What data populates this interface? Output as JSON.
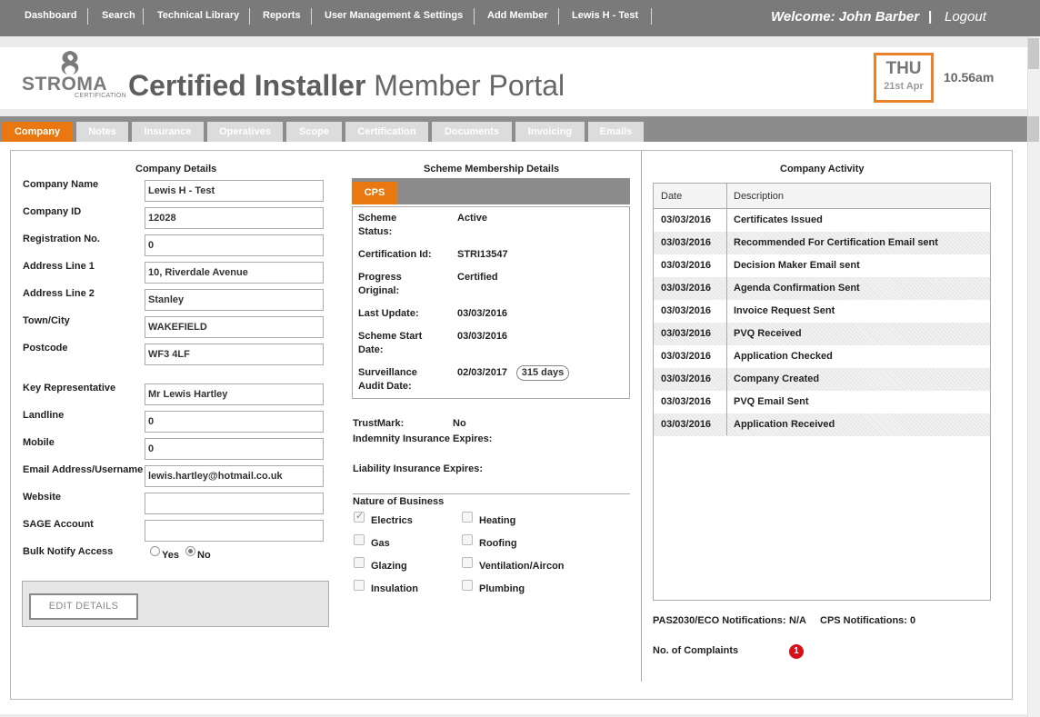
{
  "nav": {
    "items": [
      "Dashboard",
      "Search",
      "Technical Library",
      "Reports",
      "User Management & Settings",
      "Add Member",
      "Lewis H - Test"
    ],
    "welcome": "Welcome: John Barber",
    "welcome_sep": "|",
    "logout": "Logout"
  },
  "header": {
    "logo_brand": "STROMA",
    "logo_sub": "CERTIFICATION",
    "title_bold": "Certified Installer",
    "title_rest": "Member Portal",
    "day": "THU",
    "date": "21st Apr",
    "time": "10.56am"
  },
  "tabs": [
    "Company",
    "Notes",
    "Insurance",
    "Operatives",
    "Scope",
    "Certification",
    "Documents",
    "Invoicing",
    "Emails"
  ],
  "company": {
    "title": "Company Details",
    "fields": [
      {
        "label": "Company Name",
        "value": "Lewis H - Test"
      },
      {
        "label": "Company ID",
        "value": "12028"
      },
      {
        "label": "Registration No.",
        "value": "0"
      },
      {
        "label": "Address Line 1",
        "value": "10, Riverdale Avenue"
      },
      {
        "label": "Address Line 2",
        "value": "Stanley"
      },
      {
        "label": "Town/City",
        "value": "WAKEFIELD"
      },
      {
        "label": "Postcode",
        "value": "WF3 4LF"
      },
      {
        "label": "Key Representative",
        "value": "Mr Lewis Hartley"
      },
      {
        "label": "Landline",
        "value": "0"
      },
      {
        "label": "Mobile",
        "value": "0"
      },
      {
        "label": "Email Address/Username",
        "value": "lewis.hartley@hotmail.co.uk"
      },
      {
        "label": "Website",
        "value": ""
      },
      {
        "label": "SAGE Account",
        "value": ""
      }
    ],
    "bulk_label": "Bulk Notify Access",
    "bulk_yes": "Yes",
    "bulk_no": "No",
    "bulk_selected": "No",
    "edit_button": "EDIT DETAILS"
  },
  "scheme": {
    "title": "Scheme Membership Details",
    "tab": "CPS",
    "status_label": "Scheme Status:",
    "status_value": "Active",
    "cert_label": "Certification Id:",
    "cert_value": "STRI13547",
    "progress_label": "Progress Original:",
    "progress_value": "Certified",
    "last_update_label": "Last Update:",
    "last_update_value": "03/03/2016",
    "start_label": "Scheme Start Date:",
    "start_value": "03/03/2016",
    "audit_label": "Surveillance Audit Date:",
    "audit_value": "02/03/2017",
    "audit_days": "315 days",
    "trustmark_label": "TrustMark:",
    "trustmark_value": "No",
    "indemnity_label": "Indemnity Insurance Expires:",
    "liability_label": "Liability Insurance Expires:",
    "nature_title": "Nature of Business",
    "nature_left": [
      {
        "label": "Electrics",
        "checked": true
      },
      {
        "label": "Gas",
        "checked": false
      },
      {
        "label": "Glazing",
        "checked": false
      },
      {
        "label": "Insulation",
        "checked": false
      }
    ],
    "nature_right": [
      {
        "label": "Heating",
        "checked": false
      },
      {
        "label": "Roofing",
        "checked": false
      },
      {
        "label": "Ventilation/Aircon",
        "checked": false
      },
      {
        "label": "Plumbing",
        "checked": false
      }
    ]
  },
  "activity": {
    "title": "Company Activity",
    "headers": [
      "Date",
      "Description"
    ],
    "rows": [
      {
        "date": "03/03/2016",
        "desc": "Certificates Issued"
      },
      {
        "date": "03/03/2016",
        "desc": "Recommended For Certification Email sent"
      },
      {
        "date": "03/03/2016",
        "desc": "Decision Maker Email sent"
      },
      {
        "date": "03/03/2016",
        "desc": "Agenda Confirmation Sent"
      },
      {
        "date": "03/03/2016",
        "desc": "Invoice Request Sent"
      },
      {
        "date": "03/03/2016",
        "desc": "PVQ Received"
      },
      {
        "date": "03/03/2016",
        "desc": "Application Checked"
      },
      {
        "date": "03/03/2016",
        "desc": "Company Created"
      },
      {
        "date": "03/03/2016",
        "desc": "PVQ Email Sent"
      },
      {
        "date": "03/03/2016",
        "desc": "Application Received"
      }
    ],
    "pas_label": "PAS2030/ECO Notifications:",
    "pas_value": "N/A",
    "cps_label": "CPS Notifications:",
    "cps_value": "0",
    "complaints_label": "No. of Complaints",
    "complaints_value": "1"
  },
  "colors": {
    "accent": "#e8780f",
    "nav_bg": "#7a7a7a",
    "badge": "#d8101a"
  }
}
